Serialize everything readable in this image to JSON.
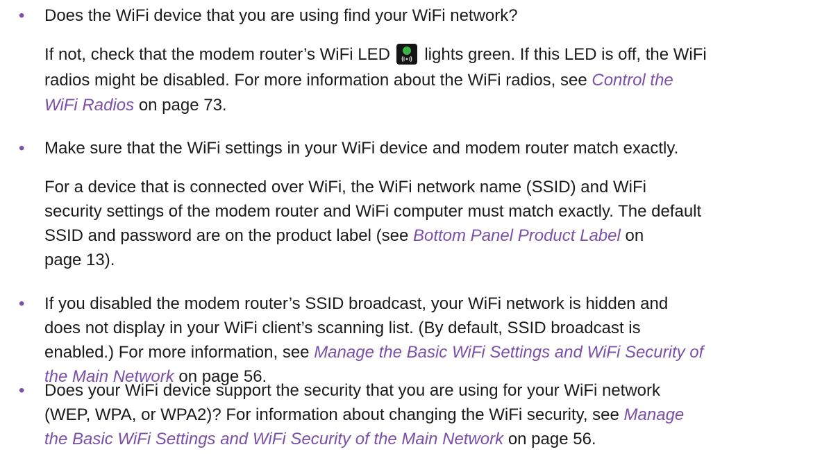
{
  "bullets": [
    {
      "question": "Does the WiFi device that you are using find your WiFi network?",
      "detail": {
        "l1_a": "If not, check that the modem router’s WiFi LED",
        "l1_b": "lights green. If this LED is off, the WiFi",
        "l2_a": "radios might be disabled. For more information about the WiFi radios, see",
        "l2_link": "Control the",
        "l3_link": "WiFi Radios",
        "l3_b": "on page 73."
      }
    },
    {
      "question": "Make sure that the WiFi settings in your WiFi device and modem router match exactly.",
      "detail": {
        "l1": "For a device that is connected over WiFi, the WiFi network name (SSID) and WiFi",
        "l2": "security settings of the modem router and WiFi computer must match exactly. The default",
        "l3_a": "SSID and password are on the product label (see",
        "l3_link": "Bottom Panel Product Label",
        "l3_b": "on",
        "l4": "page 13)."
      }
    },
    {
      "l1": "If you disabled the modem router’s SSID broadcast, your WiFi network is hidden and",
      "l2": "does not display in your WiFi client’s scanning list. (By default, SSID broadcast is",
      "l3_a": "enabled.) For more information, see",
      "l3_link": "Manage the Basic WiFi Settings and WiFi Security of",
      "l4_link": "the Main Network",
      "l4_b": "on page 56."
    },
    {
      "l1": "Does your WiFi device support the security that you are using for your WiFi network",
      "l2_a": "(WEP, WPA, or WPA2)? For information about changing the WiFi security, see",
      "l2_link": "Manage",
      "l3_link": "the Basic WiFi Settings and WiFi Security of the Main Network",
      "l3_b": "on page 56."
    }
  ],
  "bullet_glyph": "•",
  "colors": {
    "link": "#7b4fa8",
    "bullet": "#7b4fa8",
    "text": "#1a1a1a",
    "led_green": "#3bb54a"
  },
  "icons": {
    "wifi_led": "wifi-led-icon"
  }
}
